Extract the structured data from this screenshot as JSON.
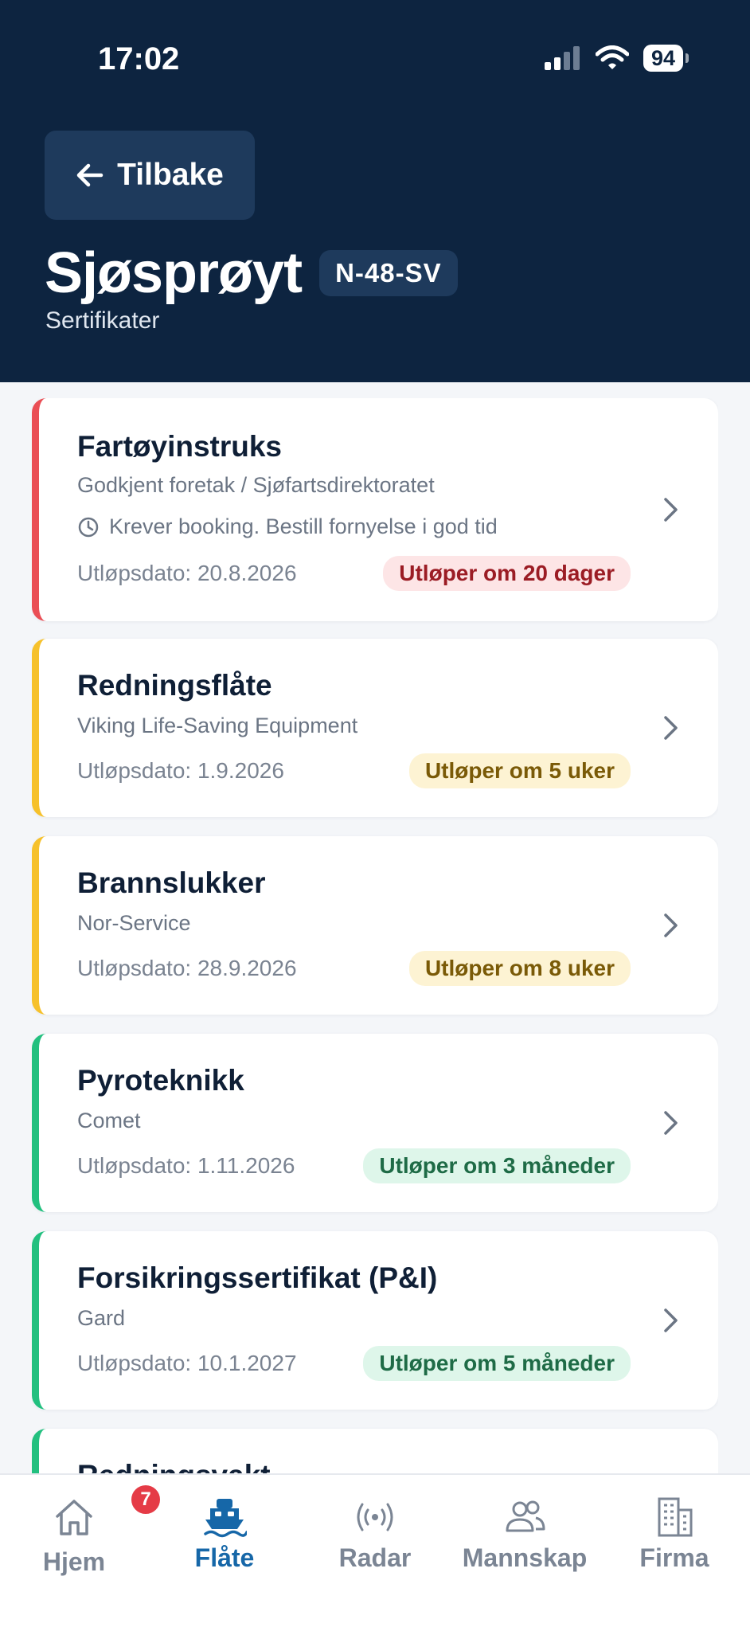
{
  "status": {
    "time": "17:02",
    "battery": "94"
  },
  "nav": {
    "back_label": "Tilbake"
  },
  "vessel": {
    "name": "Sjøsprøyt",
    "registration": "N-48-SV",
    "section": "Sertifikater"
  },
  "certificates": [
    {
      "name": "Fartøyinstruks",
      "issuer": "Godkjent foretak / Sjøfartsdirektoratet",
      "note": "Krever booking. Bestill fornyelse i god tid",
      "expiry": "Utløpsdato: 20.8.2026",
      "status": "Utløper om 20 dager",
      "severity": "red"
    },
    {
      "name": "Redningsflåte",
      "issuer": "Viking Life-Saving Equipment",
      "expiry": "Utløpsdato: 1.9.2026",
      "status": "Utløper om 5 uker",
      "severity": "yellow"
    },
    {
      "name": "Brannslukker",
      "issuer": "Nor-Service",
      "expiry": "Utløpsdato: 28.9.2026",
      "status": "Utløper om 8 uker",
      "severity": "yellow"
    },
    {
      "name": "Pyroteknikk",
      "issuer": "Comet",
      "expiry": "Utløpsdato: 1.11.2026",
      "status": "Utløper om 3 måneder",
      "severity": "green"
    },
    {
      "name": "Forsikringssertifikat (P&I)",
      "issuer": "Gard",
      "expiry": "Utløpsdato: 10.1.2027",
      "status": "Utløper om 5 måneder",
      "severity": "green"
    },
    {
      "name": "Redningsvakt",
      "severity": "green"
    }
  ],
  "colors": {
    "red": {
      "accent": "#ea4e55",
      "pill_bg": "#fde5e6",
      "pill_text": "#9b1c24"
    },
    "yellow": {
      "accent": "#f6c12b",
      "pill_bg": "#fdf3d3",
      "pill_text": "#7a5a07"
    },
    "green": {
      "accent": "#22c07f",
      "pill_bg": "#def6ea",
      "pill_text": "#1e6b46"
    },
    "header_bg": "#0d2440",
    "tab_active": "#1667a8"
  },
  "tabs": [
    {
      "label": "Hjem",
      "icon": "home-icon",
      "badge": "7"
    },
    {
      "label": "Flåte",
      "icon": "boat-icon",
      "active": true
    },
    {
      "label": "Radar",
      "icon": "radar-icon"
    },
    {
      "label": "Mannskap",
      "icon": "crew-icon"
    },
    {
      "label": "Firma",
      "icon": "building-icon"
    }
  ]
}
